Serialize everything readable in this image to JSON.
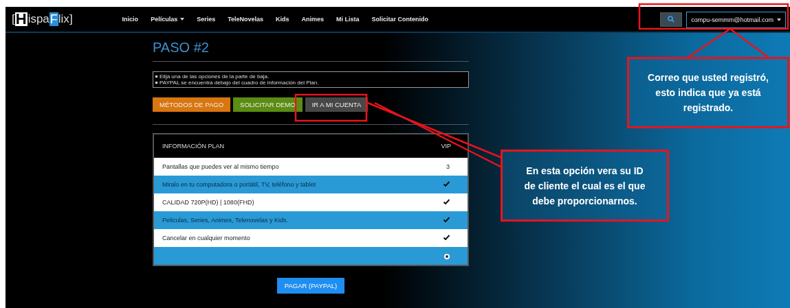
{
  "nav": {
    "logo": [
      {
        "text": "[",
        "kind": "plain"
      },
      {
        "text": "H",
        "kind": "big"
      },
      {
        "text": "ispa",
        "kind": "plain"
      },
      {
        "text": "F",
        "kind": "block"
      },
      {
        "text": "lix",
        "kind": "plain"
      },
      {
        "text": "]",
        "kind": "plain"
      }
    ],
    "menu": [
      {
        "label": "Inicio",
        "dropdown": false
      },
      {
        "label": "Películas",
        "dropdown": true
      },
      {
        "label": "Series",
        "dropdown": false
      },
      {
        "label": "TeleNovelas",
        "dropdown": false
      },
      {
        "label": "Kids",
        "dropdown": false
      },
      {
        "label": "Animes",
        "dropdown": false
      },
      {
        "label": "Mi Lista",
        "dropdown": false
      },
      {
        "label": "Solicitar Contenido",
        "dropdown": false
      }
    ],
    "account": {
      "email": "compu-semmm@hotmail.com",
      "dropdown": true
    }
  },
  "step": {
    "title": "PASO #2",
    "notes": [
      "Elija una de las opciones de la parte de baja.",
      "PAYPAL se encuentra debajo del cuadro de información del Plan."
    ]
  },
  "buttons": [
    {
      "label": "MÉTODOS DE PAGO",
      "color": "#d9760f"
    },
    {
      "label": "SOLICITAR DEMO",
      "color": "#5b8c13"
    },
    {
      "label": "IR A MI CUENTA",
      "color": "#474747"
    }
  ],
  "plan_table": {
    "columns": [
      "INFORMACIÓN PLAN",
      "VIP"
    ],
    "rows": [
      {
        "label": "Pantallas que puedes ver al mismo tiempo",
        "kind": "text",
        "value": "3"
      },
      {
        "label": "Miralo en tu computadora o portátil, TV, teléfono y tablet",
        "kind": "check"
      },
      {
        "label": "CALIDAD 720P(HD) | 1080(FHD)",
        "kind": "check"
      },
      {
        "label": "Peliculas, Series, Animes, Telenovelas y Kids.",
        "kind": "check"
      },
      {
        "label": "Cancelar en cualquier momento",
        "kind": "check"
      },
      {
        "kind": "radio",
        "selected": true
      }
    ]
  },
  "pay_button": "PAGAR (PAYPAL)",
  "annotations": [
    {
      "kind": "account",
      "text": "Correo que usted registró, esto indica que ya está registrado."
    },
    {
      "kind": "button",
      "text": "En esta opción vera su ID de cliente el cual es el que debe proporcionarnos."
    }
  ]
}
